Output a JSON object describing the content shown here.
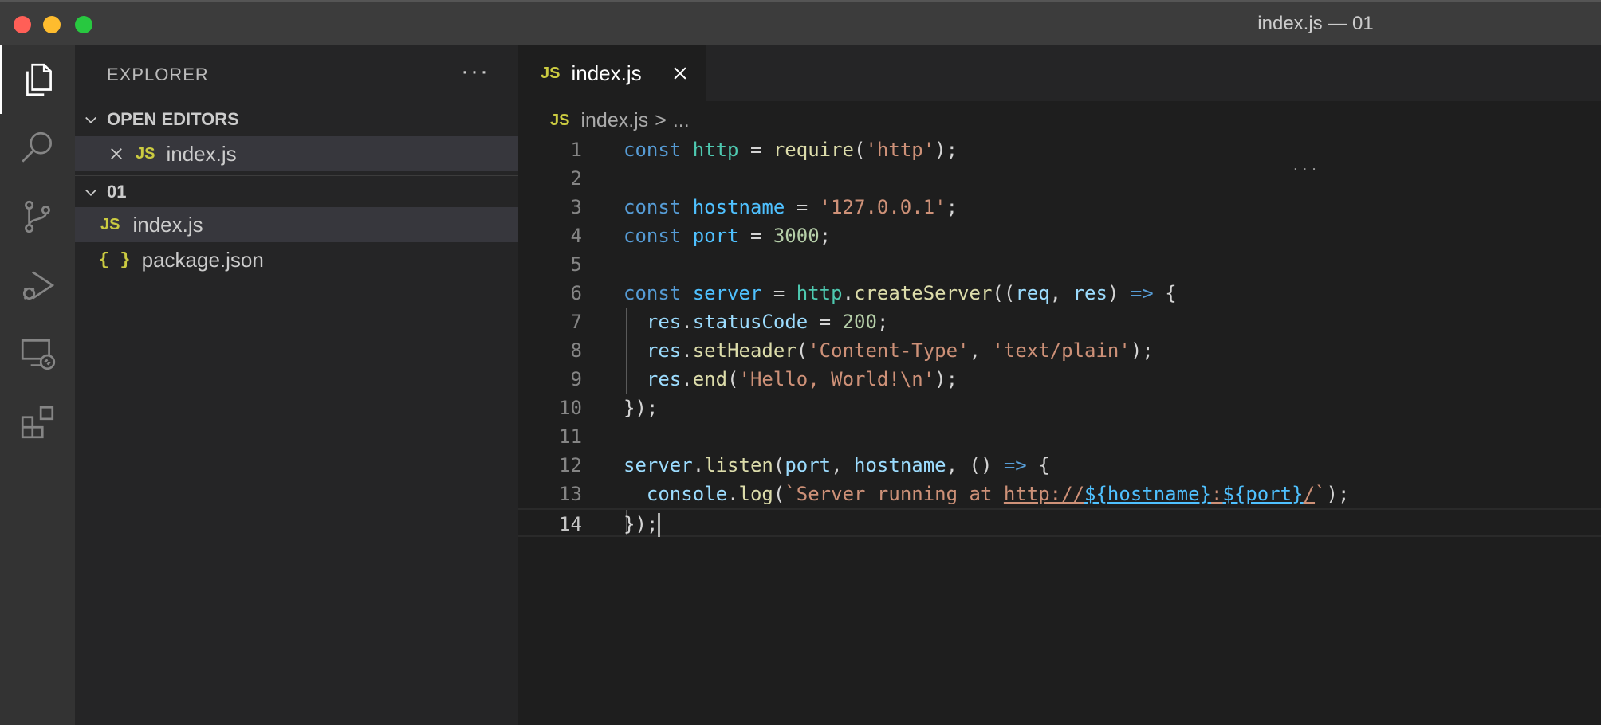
{
  "window": {
    "title": "index.js — 01"
  },
  "activity_bar": {
    "items": [
      {
        "icon": "files-icon",
        "active": true
      },
      {
        "icon": "search-icon"
      },
      {
        "icon": "source-control-icon"
      },
      {
        "icon": "run-debug-icon"
      },
      {
        "icon": "remote-explorer-icon"
      },
      {
        "icon": "extensions-icon"
      }
    ]
  },
  "sidebar": {
    "title": "EXPLORER",
    "more": "···",
    "open_editors": {
      "label": "OPEN EDITORS",
      "items": [
        {
          "badge": "JS",
          "name": "index.js"
        }
      ]
    },
    "folder": {
      "label": "01",
      "items": [
        {
          "badge": "JS",
          "name": "index.js",
          "selected": true
        },
        {
          "badge": "{ }",
          "name": "package.json"
        }
      ]
    }
  },
  "tabs": [
    {
      "badge": "JS",
      "label": "index.js",
      "active": true
    }
  ],
  "breadcrumb": {
    "badge": "JS",
    "file": "index.js",
    "separator": ">",
    "rest": "..."
  },
  "editor": {
    "current_line": 14,
    "lines": [
      {
        "n": "1",
        "tokens": [
          [
            "k",
            "const"
          ],
          [
            "o",
            " "
          ],
          [
            "c",
            "http"
          ],
          [
            "o",
            " = "
          ],
          [
            "f",
            "require"
          ],
          [
            "o",
            "("
          ],
          [
            "s",
            "'http'"
          ],
          [
            "o",
            ");"
          ]
        ]
      },
      {
        "n": "2",
        "tokens": []
      },
      {
        "n": "3",
        "tokens": [
          [
            "k",
            "const"
          ],
          [
            "o",
            " "
          ],
          [
            "v",
            "hostname"
          ],
          [
            "o",
            " = "
          ],
          [
            "s",
            "'127.0.0.1'"
          ],
          [
            "o",
            ";"
          ]
        ]
      },
      {
        "n": "4",
        "tokens": [
          [
            "k",
            "const"
          ],
          [
            "o",
            " "
          ],
          [
            "v",
            "port"
          ],
          [
            "o",
            " = "
          ],
          [
            "n",
            "3000"
          ],
          [
            "o",
            ";"
          ]
        ]
      },
      {
        "n": "5",
        "tokens": []
      },
      {
        "n": "6",
        "tokens": [
          [
            "k",
            "const"
          ],
          [
            "o",
            " "
          ],
          [
            "v",
            "server"
          ],
          [
            "o",
            " = "
          ],
          [
            "c",
            "http"
          ],
          [
            "o",
            "."
          ],
          [
            "f",
            "createServer"
          ],
          [
            "o",
            "(("
          ],
          [
            "p",
            "req"
          ],
          [
            "o",
            ", "
          ],
          [
            "p",
            "res"
          ],
          [
            "o",
            ") "
          ],
          [
            "k",
            "=>"
          ],
          [
            "o",
            " {"
          ]
        ]
      },
      {
        "n": "7",
        "tokens": [
          [
            "o",
            "  "
          ],
          [
            "p",
            "res"
          ],
          [
            "o",
            "."
          ],
          [
            "p",
            "statusCode"
          ],
          [
            "o",
            " = "
          ],
          [
            "n",
            "200"
          ],
          [
            "o",
            ";"
          ]
        ]
      },
      {
        "n": "8",
        "tokens": [
          [
            "o",
            "  "
          ],
          [
            "p",
            "res"
          ],
          [
            "o",
            "."
          ],
          [
            "f",
            "setHeader"
          ],
          [
            "o",
            "("
          ],
          [
            "s",
            "'Content-Type'"
          ],
          [
            "o",
            ", "
          ],
          [
            "s",
            "'text/plain'"
          ],
          [
            "o",
            ");"
          ]
        ]
      },
      {
        "n": "9",
        "tokens": [
          [
            "o",
            "  "
          ],
          [
            "p",
            "res"
          ],
          [
            "o",
            "."
          ],
          [
            "f",
            "end"
          ],
          [
            "o",
            "("
          ],
          [
            "s",
            "'Hello, World!\\n'"
          ],
          [
            "o",
            ");"
          ]
        ]
      },
      {
        "n": "10",
        "tokens": [
          [
            "o",
            "});"
          ]
        ]
      },
      {
        "n": "11",
        "tokens": []
      },
      {
        "n": "12",
        "tokens": [
          [
            "p",
            "server"
          ],
          [
            "o",
            "."
          ],
          [
            "f",
            "listen"
          ],
          [
            "o",
            "("
          ],
          [
            "p",
            "port"
          ],
          [
            "o",
            ", "
          ],
          [
            "p",
            "hostname"
          ],
          [
            "o",
            ", () "
          ],
          [
            "k",
            "=>"
          ],
          [
            "o",
            " {"
          ]
        ]
      },
      {
        "n": "13",
        "tokens": [
          [
            "o",
            "  "
          ],
          [
            "p",
            "console"
          ],
          [
            "o",
            "."
          ],
          [
            "f",
            "log"
          ],
          [
            "o",
            "("
          ],
          [
            "t",
            "`Server running at "
          ],
          [
            "u",
            "http://"
          ],
          [
            "interp",
            "${hostname}"
          ],
          [
            "u",
            ":"
          ],
          [
            "interp",
            "${port}"
          ],
          [
            "u",
            "/"
          ],
          [
            "t",
            "`"
          ],
          [
            "o",
            ");"
          ]
        ]
      },
      {
        "n": "14",
        "tokens": [
          [
            "o",
            "});"
          ]
        ]
      }
    ]
  },
  "colors": {
    "background": "#1e1e1e",
    "sidebar": "#252526",
    "activity_bar": "#333333",
    "title_bar": "#3c3c3c",
    "js_badge": "#cbcb41"
  }
}
